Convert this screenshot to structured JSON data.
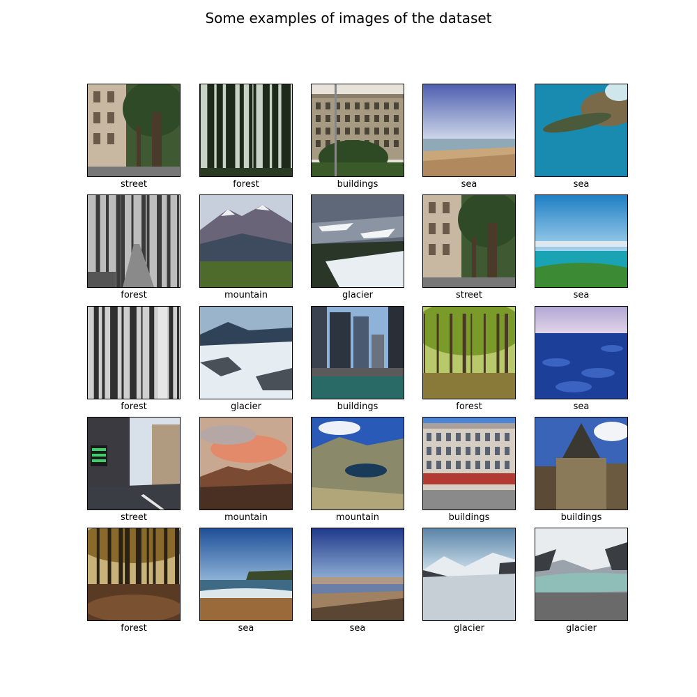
{
  "figure": {
    "title": "Some examples of images of the dataset",
    "images": [
      {
        "label": "street",
        "scene": "street"
      },
      {
        "label": "forest",
        "scene": "forest"
      },
      {
        "label": "buildings",
        "scene": "buildings"
      },
      {
        "label": "sea",
        "scene": "sea-beach"
      },
      {
        "label": "sea",
        "scene": "sea-turtle"
      },
      {
        "label": "forest",
        "scene": "forest-bw-path"
      },
      {
        "label": "mountain",
        "scene": "mountain"
      },
      {
        "label": "glacier",
        "scene": "glacier"
      },
      {
        "label": "street",
        "scene": "street"
      },
      {
        "label": "sea",
        "scene": "sea-horizon"
      },
      {
        "label": "forest",
        "scene": "forest-bw"
      },
      {
        "label": "glacier",
        "scene": "glacier-snow"
      },
      {
        "label": "buildings",
        "scene": "buildings-city"
      },
      {
        "label": "forest",
        "scene": "forest-green"
      },
      {
        "label": "sea",
        "scene": "sea-ice"
      },
      {
        "label": "street",
        "scene": "street-night"
      },
      {
        "label": "mountain",
        "scene": "mountain-sunset"
      },
      {
        "label": "mountain",
        "scene": "mountain-lake"
      },
      {
        "label": "buildings",
        "scene": "buildings-facade"
      },
      {
        "label": "buildings",
        "scene": "buildings-gothic"
      },
      {
        "label": "forest",
        "scene": "forest-autumn"
      },
      {
        "label": "sea",
        "scene": "sea-cliff"
      },
      {
        "label": "sea",
        "scene": "sea-desert"
      },
      {
        "label": "glacier",
        "scene": "glacier-valley"
      },
      {
        "label": "glacier",
        "scene": "glacier-lake"
      }
    ]
  }
}
